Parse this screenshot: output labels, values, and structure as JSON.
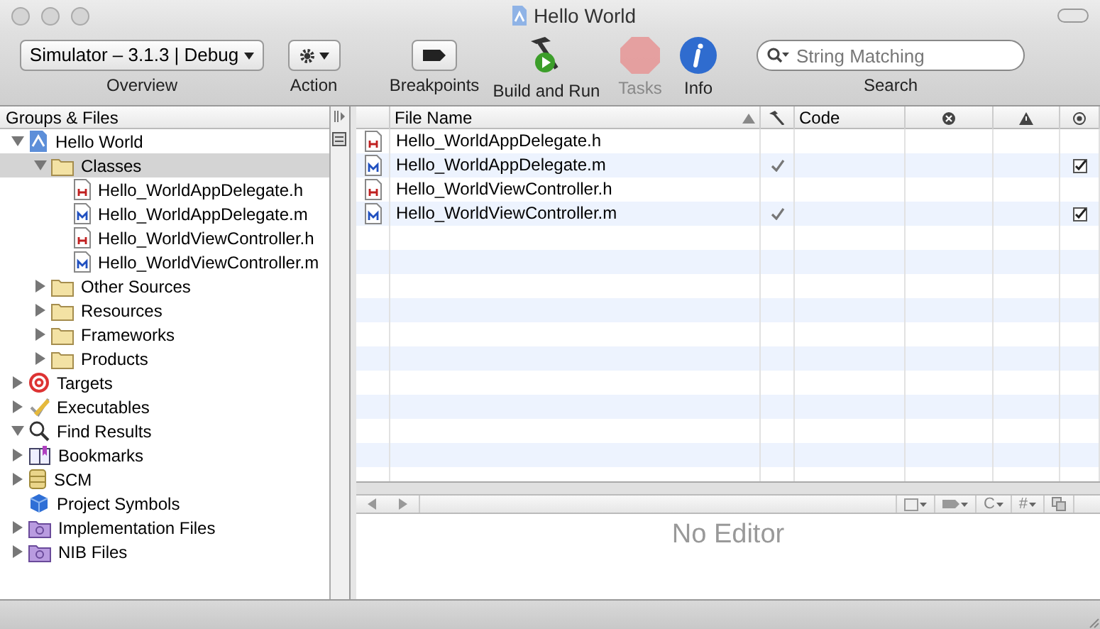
{
  "window": {
    "title": "Hello World"
  },
  "toolbar": {
    "items": [
      {
        "kind": "popup",
        "value": "Simulator – 3.1.3 | Debug",
        "label": "Overview"
      },
      {
        "kind": "gear",
        "label": "Action"
      },
      {
        "kind": "breakpoints",
        "label": "Breakpoints"
      },
      {
        "kind": "build",
        "label": "Build and Run"
      },
      {
        "kind": "tasks",
        "label": "Tasks",
        "disabled": true
      },
      {
        "kind": "info",
        "label": "Info"
      },
      {
        "kind": "search",
        "placeholder": "String Matching",
        "label": "Search"
      }
    ]
  },
  "sidebar": {
    "title": "Groups & Files",
    "items": [
      {
        "kind": "project",
        "label": "Hello World",
        "expanded": true,
        "selected": false,
        "children": [
          {
            "kind": "folder",
            "label": "Classes",
            "expanded": true,
            "selected": true,
            "children": [
              {
                "kind": "file_h",
                "label": "Hello_WorldAppDelegate.h",
                "selected": false
              },
              {
                "kind": "file_m",
                "label": "Hello_WorldAppDelegate.m",
                "selected": false
              },
              {
                "kind": "file_h",
                "label": "Hello_WorldViewController.h",
                "selected": false
              },
              {
                "kind": "file_m",
                "label": "Hello_WorldViewController.m",
                "selected": false
              }
            ]
          },
          {
            "kind": "folder",
            "label": "Other Sources",
            "expanded": false,
            "selected": false
          },
          {
            "kind": "folder",
            "label": "Resources",
            "expanded": false,
            "selected": false
          },
          {
            "kind": "folder",
            "label": "Frameworks",
            "expanded": false,
            "selected": false
          },
          {
            "kind": "folder",
            "label": "Products",
            "expanded": false,
            "selected": false
          }
        ]
      },
      {
        "kind": "target",
        "label": "Targets",
        "expanded": false,
        "selected": false
      },
      {
        "kind": "executables",
        "label": "Executables",
        "expanded": false,
        "selected": false
      },
      {
        "kind": "find",
        "label": "Find Results",
        "expanded": true,
        "selected": false
      },
      {
        "kind": "bookmarks",
        "label": "Bookmarks",
        "expanded": false,
        "selected": false
      },
      {
        "kind": "scm",
        "label": "SCM",
        "expanded": false,
        "selected": false
      },
      {
        "kind": "symbols",
        "label": "Project Symbols",
        "selected": false
      },
      {
        "kind": "smart_group",
        "label": "Implementation Files",
        "expanded": false,
        "selected": false
      },
      {
        "kind": "smart_group",
        "label": "NIB Files",
        "expanded": false,
        "selected": false
      }
    ]
  },
  "table": {
    "columns": [
      {
        "kind": "icon"
      },
      {
        "kind": "text",
        "label": "File Name"
      },
      {
        "kind": "build"
      },
      {
        "kind": "text",
        "label": "Code"
      },
      {
        "kind": "errors"
      },
      {
        "kind": "warnings"
      },
      {
        "kind": "target"
      }
    ],
    "rows": [
      {
        "kind": "file_h",
        "name": "Hello_WorldAppDelegate.h",
        "build": false,
        "target": false
      },
      {
        "kind": "file_m",
        "name": "Hello_WorldAppDelegate.m",
        "build": true,
        "target": true
      },
      {
        "kind": "file_h",
        "name": "Hello_WorldViewController.h",
        "build": false,
        "target": false
      },
      {
        "kind": "file_m",
        "name": "Hello_WorldViewController.m",
        "build": true,
        "target": true
      }
    ]
  },
  "editor": {
    "toolbar": [
      {
        "kind": "file_menu"
      },
      {
        "kind": "bookmark_menu"
      },
      {
        "kind": "text",
        "label": "C"
      },
      {
        "kind": "text",
        "label": "#"
      },
      {
        "kind": "split"
      }
    ],
    "message": "No Editor"
  }
}
